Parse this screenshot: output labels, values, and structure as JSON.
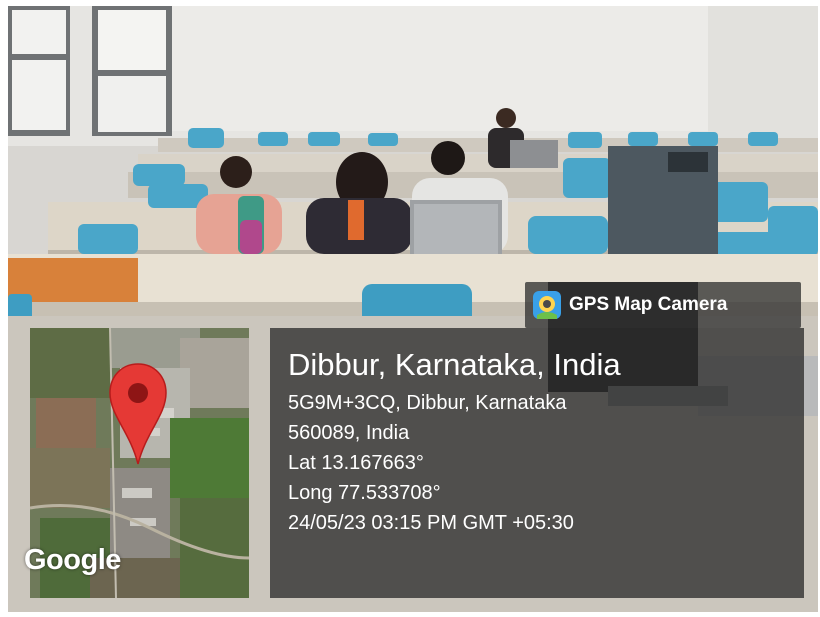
{
  "app": {
    "name": "GPS Map Camera",
    "icon": "gps-map-camera-icon"
  },
  "map": {
    "provider_label": "Google",
    "marker_icon": "location-pin-icon",
    "marker_color": "#e53935"
  },
  "location": {
    "title": "Dibbur, Karnataka, India",
    "address_line1": "5G9M+3CQ, Dibbur, Karnataka",
    "address_line2": "560089, India",
    "latitude": "Lat 13.167663°",
    "longitude": "Long 77.533708°",
    "timestamp": "24/05/23 03:15 PM GMT +05:30"
  }
}
